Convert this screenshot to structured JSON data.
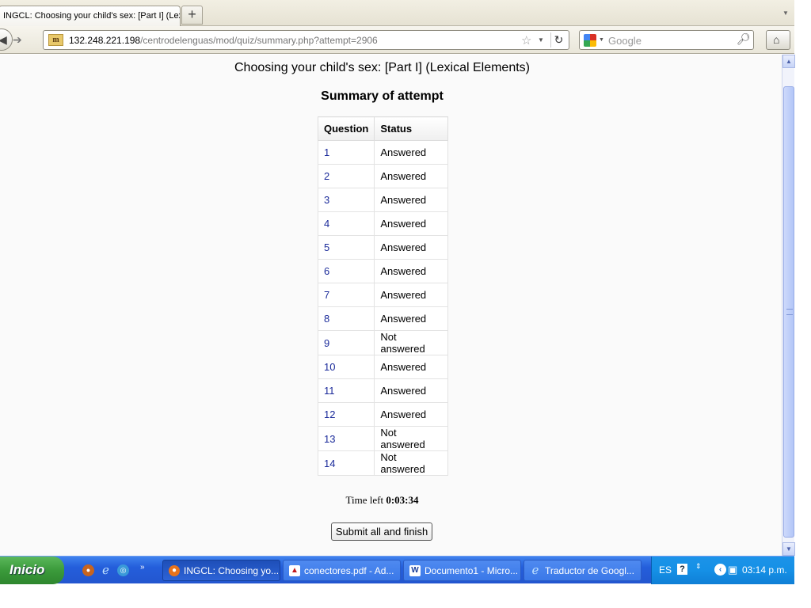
{
  "browser": {
    "tab_title": "INGCL: Choosing your child's sex: [Part I] (Lex...",
    "new_tab_label": "+",
    "url_host": "132.248.221.198",
    "url_path": "/centrodelenguas/mod/quiz/summary.php?attempt=2906",
    "search_placeholder": "Google",
    "site_icon_text": "m"
  },
  "page": {
    "title": "Choosing your child's sex: [Part I] (Lexical Elements)",
    "summary_heading": "Summary of attempt",
    "table_headers": {
      "question": "Question",
      "status": "Status"
    },
    "rows": [
      {
        "question": "1",
        "status": "Answered"
      },
      {
        "question": "2",
        "status": "Answered"
      },
      {
        "question": "3",
        "status": "Answered"
      },
      {
        "question": "4",
        "status": "Answered"
      },
      {
        "question": "5",
        "status": "Answered"
      },
      {
        "question": "6",
        "status": "Answered"
      },
      {
        "question": "7",
        "status": "Answered"
      },
      {
        "question": "8",
        "status": "Answered"
      },
      {
        "question": "9",
        "status": "Not answered"
      },
      {
        "question": "10",
        "status": "Answered"
      },
      {
        "question": "11",
        "status": "Answered"
      },
      {
        "question": "12",
        "status": "Answered"
      },
      {
        "question": "13",
        "status": "Not answered"
      },
      {
        "question": "14",
        "status": "Not answered"
      }
    ],
    "time_left_label": "Time left",
    "time_left_value": "0:03:34",
    "submit_label": "Submit all and finish"
  },
  "taskbar": {
    "start_label": "Inicio",
    "tasks": [
      {
        "label": "INGCL: Choosing yo...",
        "icon": "firefox-icon"
      },
      {
        "label": "conectores.pdf - Ad...",
        "icon": "pdf-icon"
      },
      {
        "label": "Documento1 - Micro...",
        "icon": "word-icon"
      },
      {
        "label": "Traductor de Googl...",
        "icon": "ie-icon"
      }
    ],
    "language": "ES",
    "clock": "03:14 p.m."
  },
  "colors": {
    "link": "#1a2a9a",
    "taskbar_blue": "#245edb",
    "start_green": "#3b9a3b"
  }
}
